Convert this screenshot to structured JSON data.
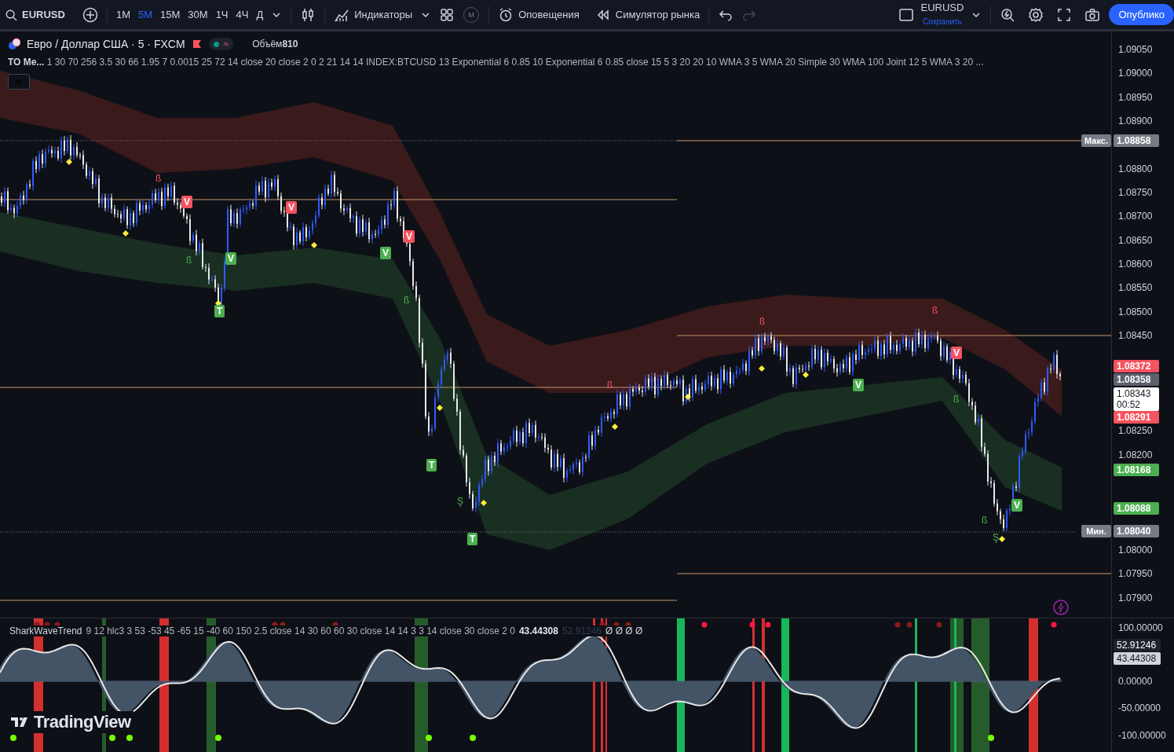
{
  "toolbar": {
    "symbol": "EURUSD",
    "intervals": [
      {
        "label": "1M",
        "selected": false
      },
      {
        "label": "5M",
        "selected": true
      },
      {
        "label": "15M",
        "selected": false
      },
      {
        "label": "30M",
        "selected": false
      },
      {
        "label": "1Ч",
        "selected": false
      },
      {
        "label": "4Ч",
        "selected": false
      },
      {
        "label": "Д",
        "selected": false
      }
    ],
    "indicators_label": "Индикаторы",
    "mode_badge": "М",
    "alerts_label": "Оповещения",
    "replay_label": "Симулятор рынка",
    "history": [
      {
        "kind": "undo",
        "disabled": false
      },
      {
        "kind": "redo",
        "disabled": true
      }
    ],
    "layout": {
      "name": "EURUSD",
      "status": "Сохранить"
    },
    "publish_label": "Опублико"
  },
  "legend": {
    "title": "Евро / Доллар США · 5 · FXCM",
    "status_icon": "≈",
    "volume_label": "Объём",
    "volume_value": "810",
    "indicator_name": "ТО Ме...",
    "indicator_params": "1 30 70 256 3.5 30 66 1.95 7 0.0015 25 72 14 close 20 close 2 0 2 21 14 14 INDEX:BTCUSD 13 Exponential 6 0.85 10 Exponential 6 0.85 close 15 5 3 20 20 10 WMA 3 5 WMA 20 Simple 30 WMA 100 Joint 12 5 WMA 3 20 ..."
  },
  "signals": [
    {
      "text": "ß",
      "kind": "sell-letter"
    },
    {
      "text": "V",
      "kind": "sell-box"
    },
    {
      "text": "ß",
      "kind": "buy-letter"
    },
    {
      "text": "T",
      "kind": "buy-box"
    },
    {
      "text": "V",
      "kind": "buy-box"
    },
    {
      "text": "V",
      "kind": "sell-box"
    },
    {
      "text": "V",
      "kind": "buy-box"
    },
    {
      "text": "V",
      "kind": "sell-box"
    },
    {
      "text": "ß",
      "kind": "buy-letter"
    },
    {
      "text": "T",
      "kind": "buy-box"
    },
    {
      "text": "Ş",
      "kind": "buy-letter"
    },
    {
      "text": "T",
      "kind": "buy-box"
    },
    {
      "text": "ß",
      "kind": "sell-letter"
    },
    {
      "text": "ß",
      "kind": "sell-letter"
    },
    {
      "text": "V",
      "kind": "buy-box"
    },
    {
      "text": "ß",
      "kind": "sell-letter"
    },
    {
      "text": "V",
      "kind": "sell-box"
    },
    {
      "text": "ß",
      "kind": "buy-letter"
    },
    {
      "text": "ß",
      "kind": "buy-letter"
    },
    {
      "text": "Ş",
      "kind": "buy-letter"
    },
    {
      "text": "V",
      "kind": "buy-box"
    }
  ],
  "price_axis": {
    "ticks": [
      "1.09050",
      "1.09000",
      "1.08950",
      "1.08900",
      "1.08800",
      "1.08750",
      "1.08700",
      "1.08650",
      "1.08600",
      "1.08550",
      "1.08500",
      "1.08450",
      "1.08250",
      "1.08200",
      "1.08000",
      "1.07950",
      "1.07900"
    ],
    "tags": [
      {
        "label": "Макс.",
        "value": "1.08858",
        "color": "#787b86"
      },
      {
        "value": "1.08372",
        "color": "#f7525f"
      },
      {
        "value": "1.08358",
        "color": "#5d606b"
      },
      {
        "value": "1.08343",
        "countdown": "00:52",
        "color": "#ffffff"
      },
      {
        "value": "1.08291",
        "color": "#f7525f"
      },
      {
        "value": "1.08168",
        "color": "#4caf50"
      },
      {
        "value": "1.08088",
        "color": "#4caf50"
      },
      {
        "label": "Мин.",
        "value": "1.08040",
        "color": "#787b86"
      }
    ]
  },
  "oscillator": {
    "name": "SharkWaveTrend",
    "params": "9 12 hlc3 3 53 -53 45 -65 15 -40 60 150 2.5 close 14 30 60 60 30 close 14 14 3 3 14 close 30 close 2 0",
    "value_1": "43.44308",
    "value_2": "52.91246",
    "flags": "Ø Ø Ø Ø",
    "axis_ticks": [
      "100.00000",
      "0.00000",
      "-50.00000",
      "-100.00000"
    ],
    "tags": [
      {
        "value": "52.91246",
        "color": "#1e222d"
      },
      {
        "value": "43.44308",
        "color": "#d1d4dc"
      }
    ]
  },
  "logo": "TradingView"
}
